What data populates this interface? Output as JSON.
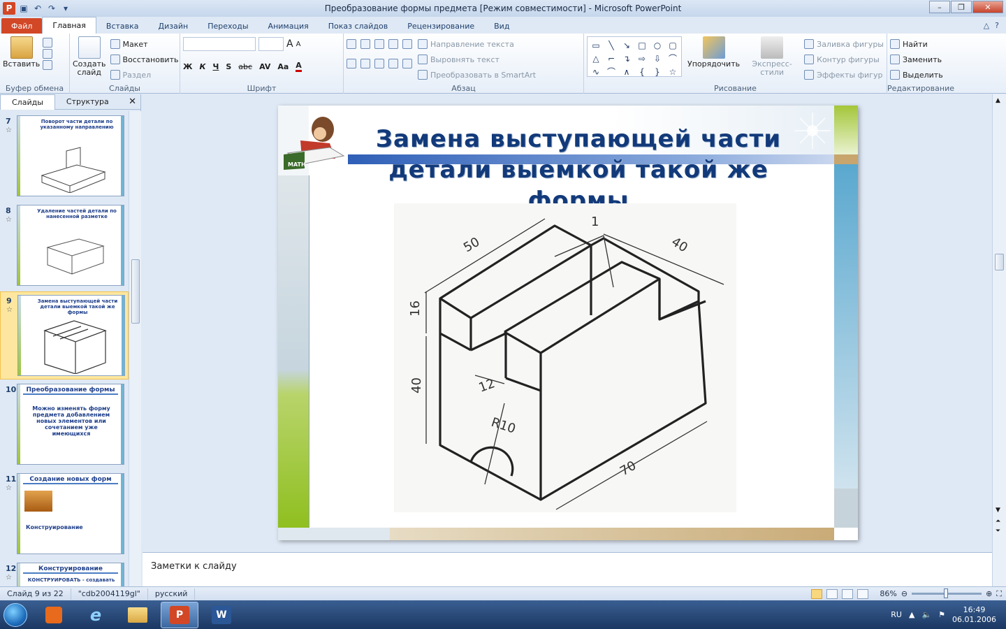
{
  "window": {
    "title": "Преобразование формы предмета [Режим совместимости] - Microsoft PowerPoint",
    "app_icon": "P",
    "controls": [
      "–",
      "❐",
      "✕"
    ]
  },
  "tabs": {
    "file": "Файл",
    "items": [
      "Главная",
      "Вставка",
      "Дизайн",
      "Переходы",
      "Анимация",
      "Показ слайдов",
      "Рецензирование",
      "Вид"
    ],
    "active": "Главная"
  },
  "ribbon": {
    "clipboard": {
      "paste": "Вставить",
      "group": "Буфер обмена"
    },
    "slides": {
      "new_slide_1": "Создать",
      "new_slide_2": "слайд",
      "layout": "Макет",
      "reset": "Восстановить",
      "section": "Раздел",
      "group": "Слайды"
    },
    "font": {
      "group": "Шрифт",
      "bold": "Ж",
      "italic": "К",
      "underline": "Ч",
      "shadow": "S",
      "strike": "abc",
      "spacing": "AV",
      "case": "Aa",
      "color": "A",
      "grow": "A",
      "shrink": "A"
    },
    "paragraph": {
      "group": "Абзац",
      "text_direction": "Направление текста",
      "align_text": "Выровнять текст",
      "smartart": "Преобразовать в SmartArt"
    },
    "drawing": {
      "group": "Рисование",
      "arrange": "Упорядочить",
      "quick_styles": "Экспресс-стили",
      "fill": "Заливка фигуры",
      "outline": "Контур фигуры",
      "effects": "Эффекты фигур"
    },
    "editing": {
      "group": "Редактирование",
      "find": "Найти",
      "replace": "Заменить",
      "select": "Выделить"
    }
  },
  "left_pane": {
    "tab_slides": "Слайды",
    "tab_outline": "Структура",
    "close": "✕",
    "thumbnails": [
      {
        "num": "7",
        "title": "Поворот части детали по указанному направлению"
      },
      {
        "num": "8",
        "title": "Удаление частей детали по нанесенной разметке"
      },
      {
        "num": "9",
        "title": "Замена выступающей части детали выемкой такой же формы"
      },
      {
        "num": "10",
        "title": "Преобразование формы",
        "body": "Можно изменять форму предмета добавлением новых элементов или сочетанием уже имеющихся"
      },
      {
        "num": "11",
        "title": "Создание новых форм",
        "body": "Конструирование"
      },
      {
        "num": "12",
        "title": "Конструирование",
        "body": "КОНСТРУИРОВАТЬ - создавать"
      }
    ],
    "selected": "9"
  },
  "slide": {
    "title": "Замена выступающей части детали выемкой такой же формы",
    "logo_text": "MATH",
    "drawing_labels": {
      "d50": "50",
      "d40_top": "40",
      "d16": "16",
      "d40_left": "40",
      "d12": "12",
      "r10": "R10",
      "d70": "70",
      "callout": "1"
    }
  },
  "notes": {
    "placeholder": "Заметки к слайду"
  },
  "status": {
    "slide_of": "Слайд 9 из 22",
    "theme": "\"cdb2004119gl\"",
    "lang": "русский",
    "zoom": "86%"
  },
  "taskbar": {
    "lang": "RU",
    "time": "16:49",
    "date": "06.01.2006"
  }
}
